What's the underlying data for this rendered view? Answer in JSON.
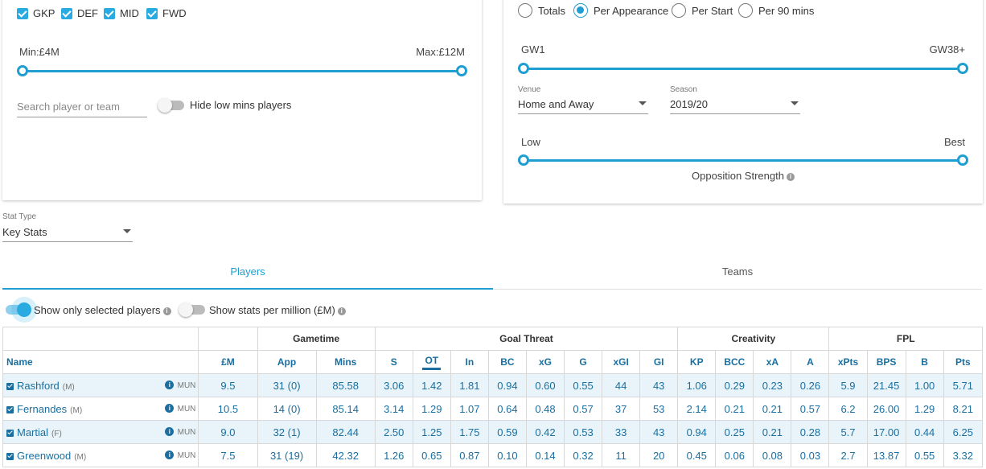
{
  "positions": [
    {
      "label": "GKP"
    },
    {
      "label": "DEF"
    },
    {
      "label": "MID"
    },
    {
      "label": "FWD"
    }
  ],
  "price_slider": {
    "min_label": "Min:£4M",
    "max_label": "Max:£12M"
  },
  "search": {
    "placeholder": "Search player or team"
  },
  "hide_low_mins": {
    "label": "Hide low mins players"
  },
  "stat_modes": [
    {
      "label": "Totals",
      "selected": false
    },
    {
      "label": "Per Appearance",
      "selected": true
    },
    {
      "label": "Per Start",
      "selected": false
    },
    {
      "label": "Per 90 mins",
      "selected": false
    }
  ],
  "gw_slider": {
    "min_label": "GW1",
    "max_label": "GW38+"
  },
  "venue": {
    "label": "Venue",
    "value": "Home and Away"
  },
  "season": {
    "label": "Season",
    "value": "2019/20"
  },
  "opposition_slider": {
    "low_label": "Low",
    "high_label": "Best",
    "title": "Opposition Strength"
  },
  "stat_type": {
    "label": "Stat Type",
    "value": "Key Stats"
  },
  "tabs": [
    {
      "label": "Players"
    },
    {
      "label": "Teams"
    }
  ],
  "toggles": {
    "show_selected": "Show only selected players",
    "per_million": "Show stats per million (£M)"
  },
  "table": {
    "groups": [
      "Gametime",
      "Goal Threat",
      "Creativity",
      "FPL"
    ],
    "headers": [
      "Name",
      "£M",
      "App",
      "Mins",
      "S",
      "OT",
      "In",
      "BC",
      "xG",
      "G",
      "xGI",
      "GI",
      "KP",
      "BCC",
      "xA",
      "A",
      "xPts",
      "BPS",
      "B",
      "Pts"
    ],
    "rows": [
      {
        "name": "Rashford",
        "pos": "(M)",
        "team": "MUN",
        "cells": [
          "9.5",
          "31 (0)",
          "85.58",
          "3.06",
          "1.42",
          "1.81",
          "0.94",
          "0.60",
          "0.55",
          "44",
          "43",
          "1.06",
          "0.29",
          "0.23",
          "0.26",
          "5.9",
          "21.45",
          "1.00",
          "5.71"
        ]
      },
      {
        "name": "Fernandes",
        "pos": "(M)",
        "team": "MUN",
        "cells": [
          "10.5",
          "14 (0)",
          "85.14",
          "3.14",
          "1.29",
          "1.07",
          "0.64",
          "0.48",
          "0.57",
          "37",
          "53",
          "2.14",
          "0.21",
          "0.21",
          "0.57",
          "6.2",
          "26.00",
          "1.29",
          "8.21"
        ]
      },
      {
        "name": "Martial",
        "pos": "(F)",
        "team": "MUN",
        "cells": [
          "9.0",
          "32 (1)",
          "82.44",
          "2.50",
          "1.25",
          "1.75",
          "0.59",
          "0.42",
          "0.53",
          "33",
          "43",
          "0.94",
          "0.25",
          "0.21",
          "0.28",
          "5.7",
          "17.00",
          "0.44",
          "6.25"
        ]
      },
      {
        "name": "Greenwood",
        "pos": "(M)",
        "team": "MUN",
        "cells": [
          "7.5",
          "31 (19)",
          "42.32",
          "1.26",
          "0.65",
          "0.87",
          "0.10",
          "0.14",
          "0.32",
          "11",
          "20",
          "0.45",
          "0.06",
          "0.08",
          "0.03",
          "2.7",
          "13.87",
          "0.55",
          "3.32"
        ]
      }
    ]
  }
}
